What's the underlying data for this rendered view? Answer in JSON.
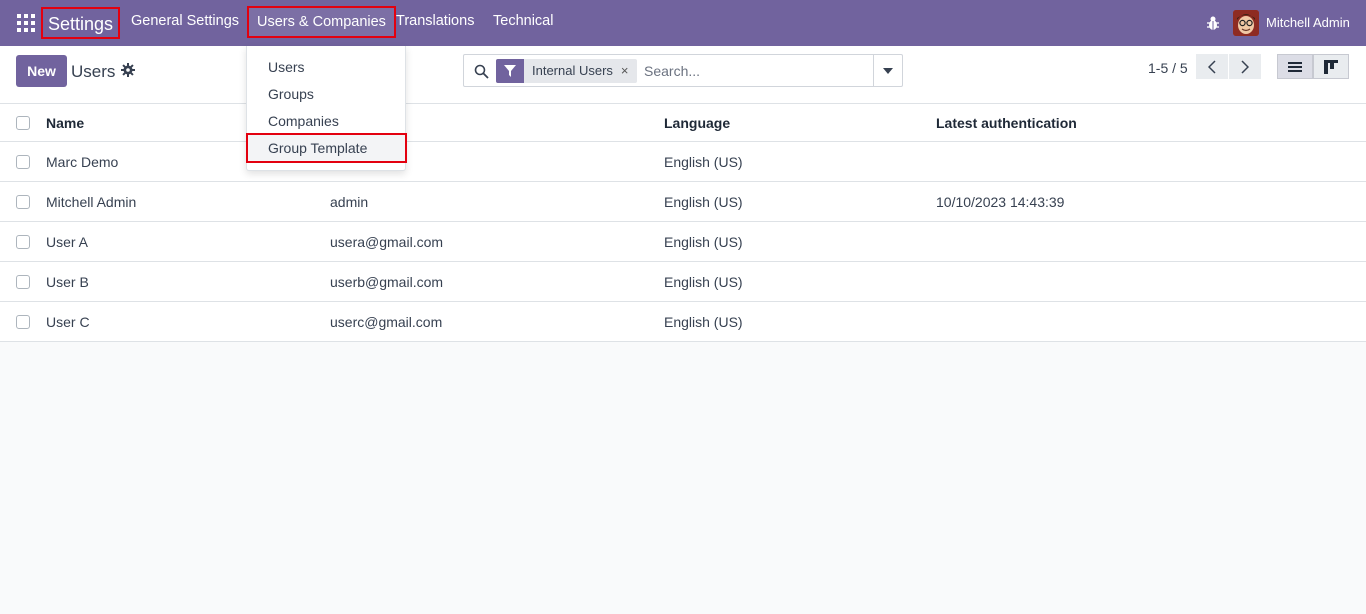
{
  "navbar": {
    "brand": "Settings",
    "menu": [
      "General Settings",
      "Users & Companies",
      "Translations",
      "Technical"
    ],
    "user_name": "Mitchell Admin"
  },
  "dropdown": {
    "items": [
      "Users",
      "Groups",
      "Companies",
      "Group Template"
    ]
  },
  "control": {
    "new_label": "New",
    "breadcrumb": "Users",
    "facet_label": "Internal Users",
    "facet_remove": "×",
    "search_placeholder": "Search...",
    "pager": "1-5 / 5"
  },
  "table": {
    "headers": [
      "Name",
      "",
      "Language",
      "Latest authentication"
    ],
    "rows": [
      [
        "Marc Demo",
        "",
        "English (US)",
        ""
      ],
      [
        "Mitchell Admin",
        "admin",
        "English (US)",
        "10/10/2023 14:43:39"
      ],
      [
        "User A",
        "usera@gmail.com",
        "English (US)",
        ""
      ],
      [
        "User B",
        "userb@gmail.com",
        "English (US)",
        ""
      ],
      [
        "User C",
        "userc@gmail.com",
        "English (US)",
        ""
      ]
    ]
  },
  "colors": {
    "brand": "#71639e",
    "highlight": "#e3000f"
  }
}
